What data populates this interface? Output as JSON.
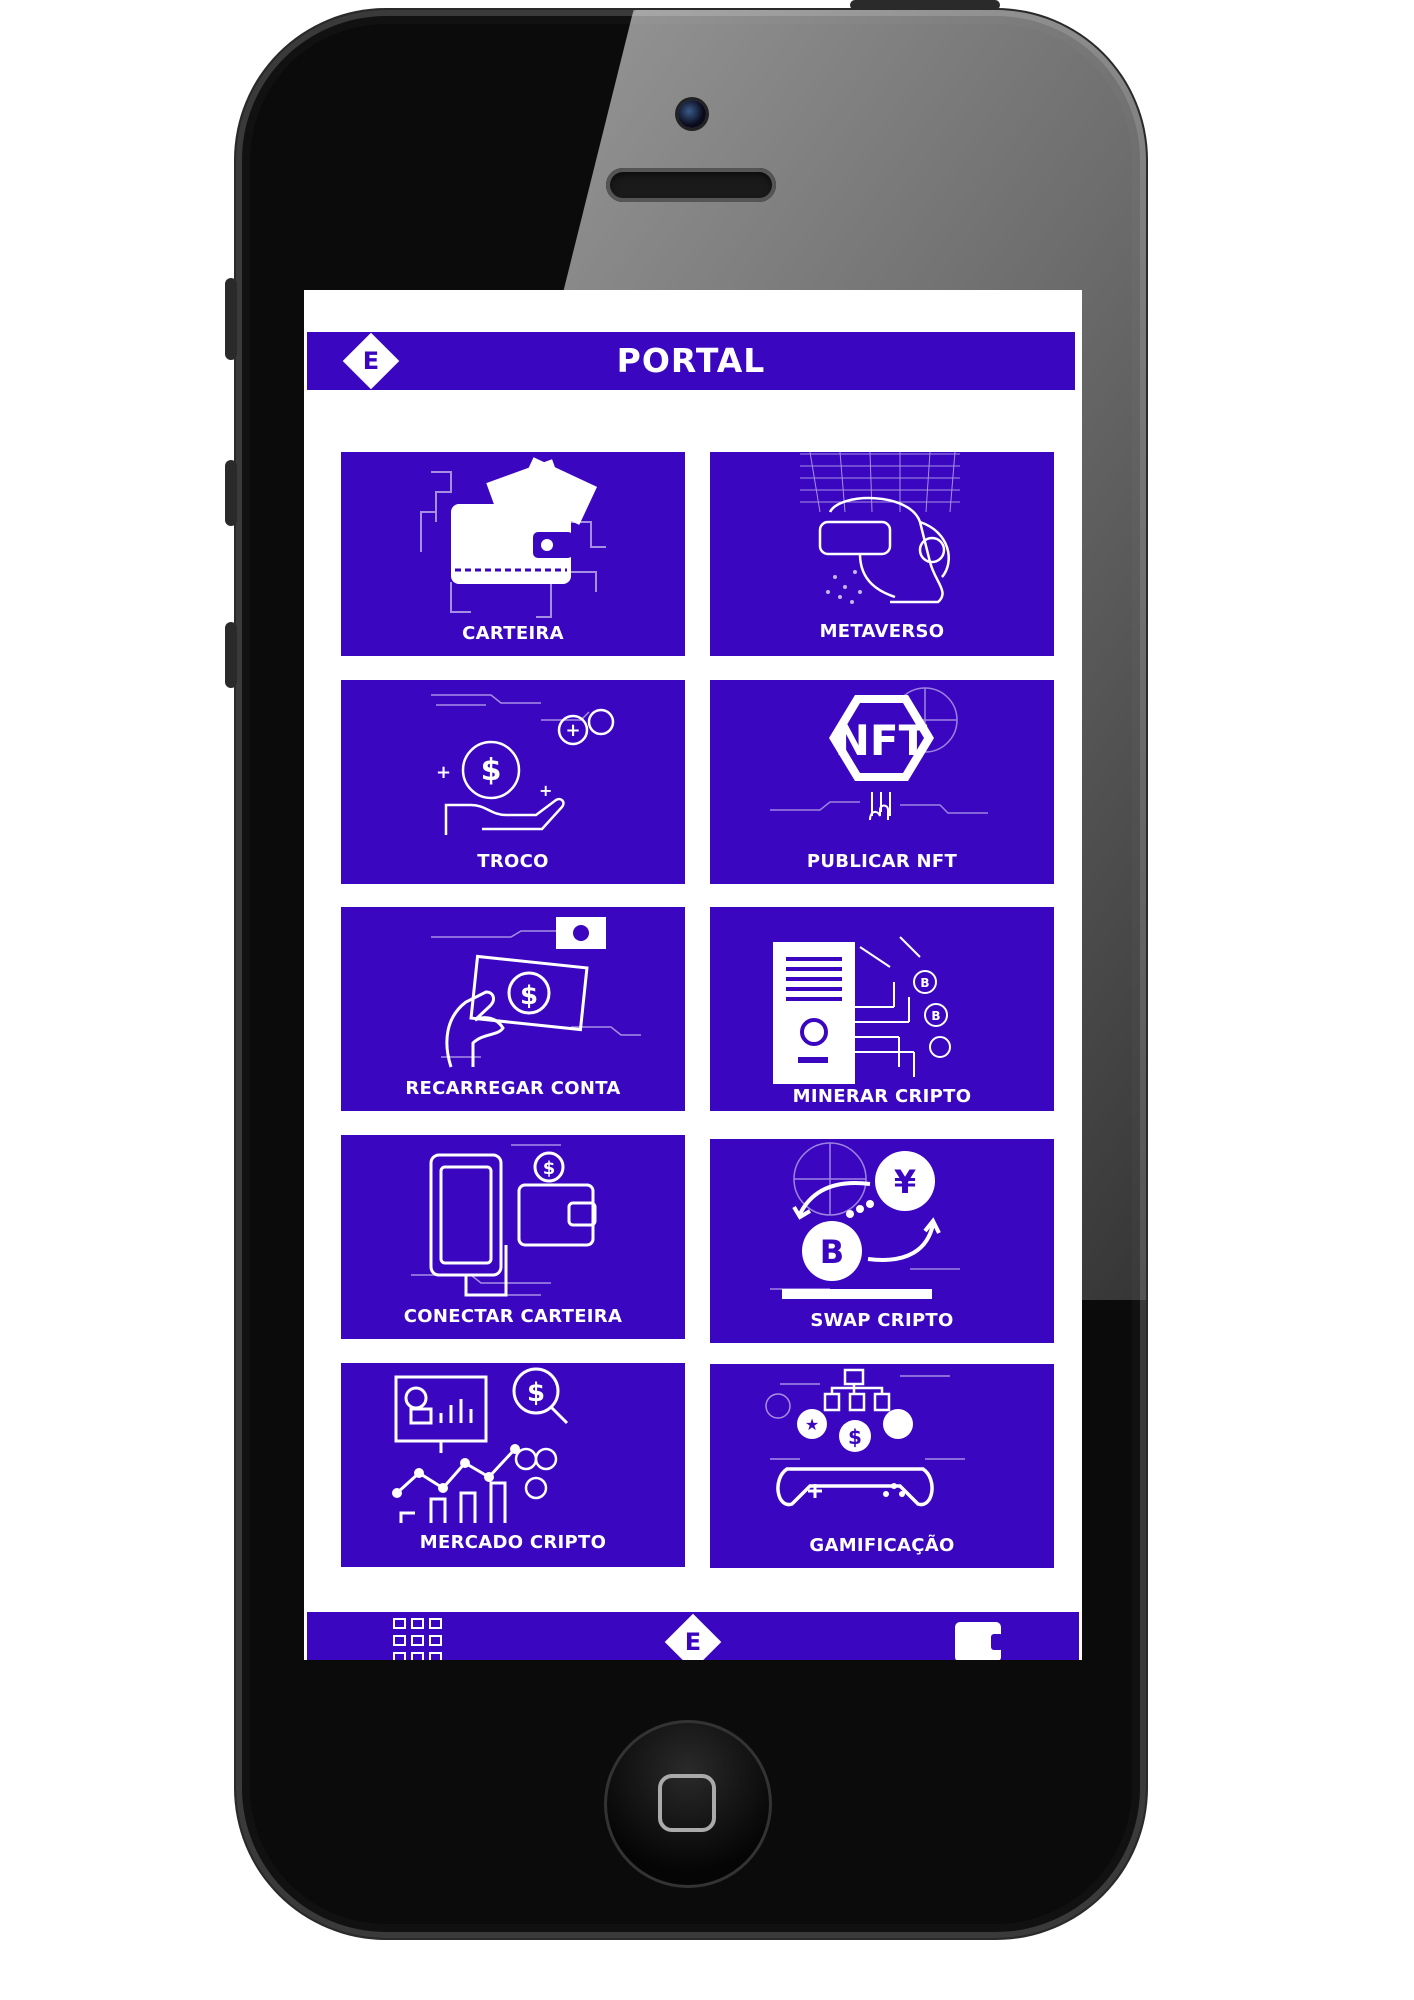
{
  "header": {
    "title": "PORTAL",
    "logo_letter": "E"
  },
  "tiles": [
    {
      "label": "CARTEIRA",
      "icon": "wallet-icon"
    },
    {
      "label": "METAVERSO",
      "icon": "vr-headset-icon"
    },
    {
      "label": "TROCO",
      "icon": "hand-coin-icon"
    },
    {
      "label": "PUBLICAR NFT",
      "icon": "nft-icon"
    },
    {
      "label": "RECARREGAR CONTA",
      "icon": "hand-banknote-icon"
    },
    {
      "label": "MINERAR CRIPTO",
      "icon": "mining-server-icon"
    },
    {
      "label": "CONECTAR CARTEIRA",
      "icon": "phone-wallet-icon"
    },
    {
      "label": "SWAP CRIPTO",
      "icon": "swap-icon"
    },
    {
      "label": "MERCADO CRIPTO",
      "icon": "market-chart-icon"
    },
    {
      "label": "GAMIFICAÇÃO",
      "icon": "gamepad-icon"
    }
  ],
  "bottom_nav": {
    "logo_letter": "E",
    "left_icon": "grid-icon",
    "right_icon": "wallet-icon"
  },
  "colors": {
    "accent": "#3a06c0",
    "foreground": "#ffffff"
  }
}
